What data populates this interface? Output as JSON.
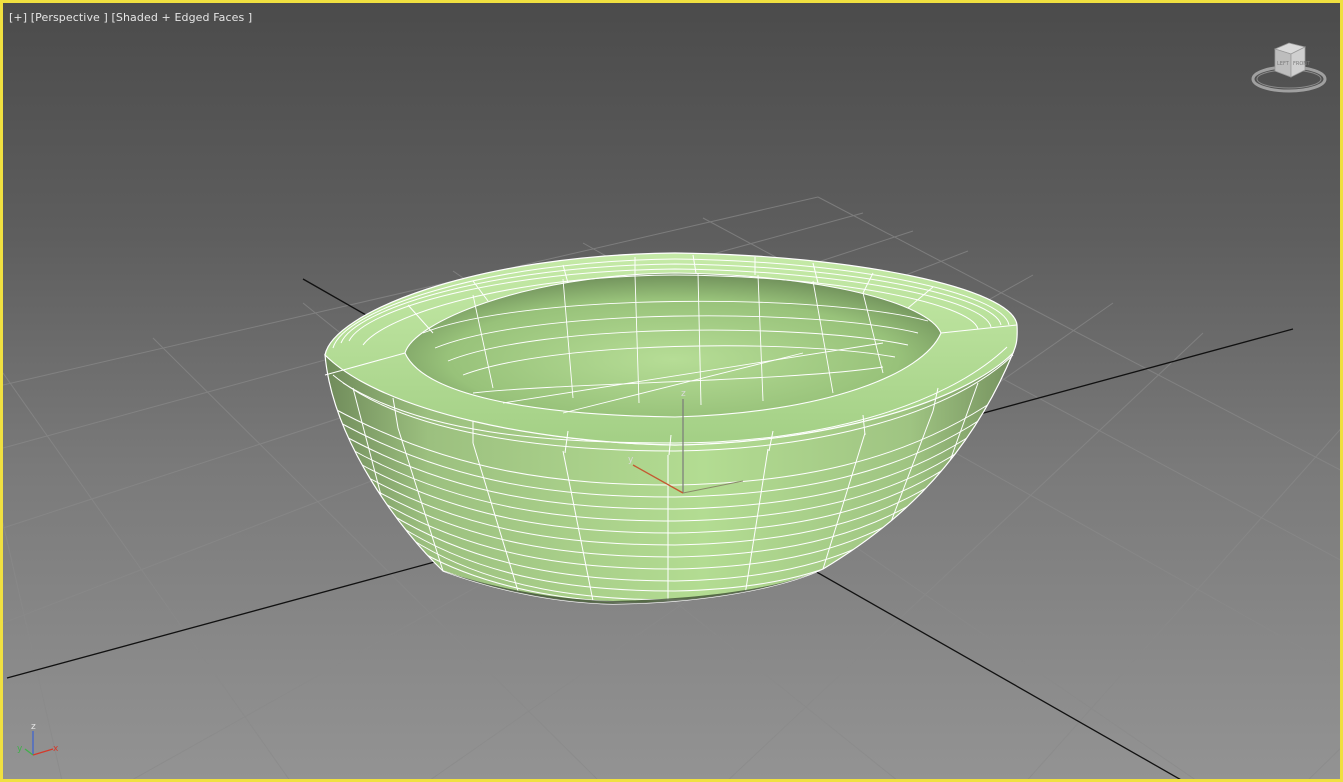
{
  "viewport": {
    "label_plus": "[+]",
    "label_view": "[Perspective ]",
    "label_shading": "[Shaded + Edged Faces ]",
    "border_color": "#f0e040",
    "active": true
  },
  "viewcube": {
    "face_top": "TOP",
    "face_front": "FRONT",
    "face_left": "LEFT",
    "icon": "viewcube-icon"
  },
  "object": {
    "type": "tub-bowl-mesh",
    "color": "#a9d689",
    "edge_color": "#ffffff",
    "selected": true
  },
  "gizmo": {
    "z": "z",
    "y": "y"
  },
  "axis_tripod": {
    "x": "x",
    "y": "y",
    "z": "z",
    "x_color": "#d43a2a",
    "y_color": "#3fb04a",
    "z_color": "#3a62d4"
  }
}
